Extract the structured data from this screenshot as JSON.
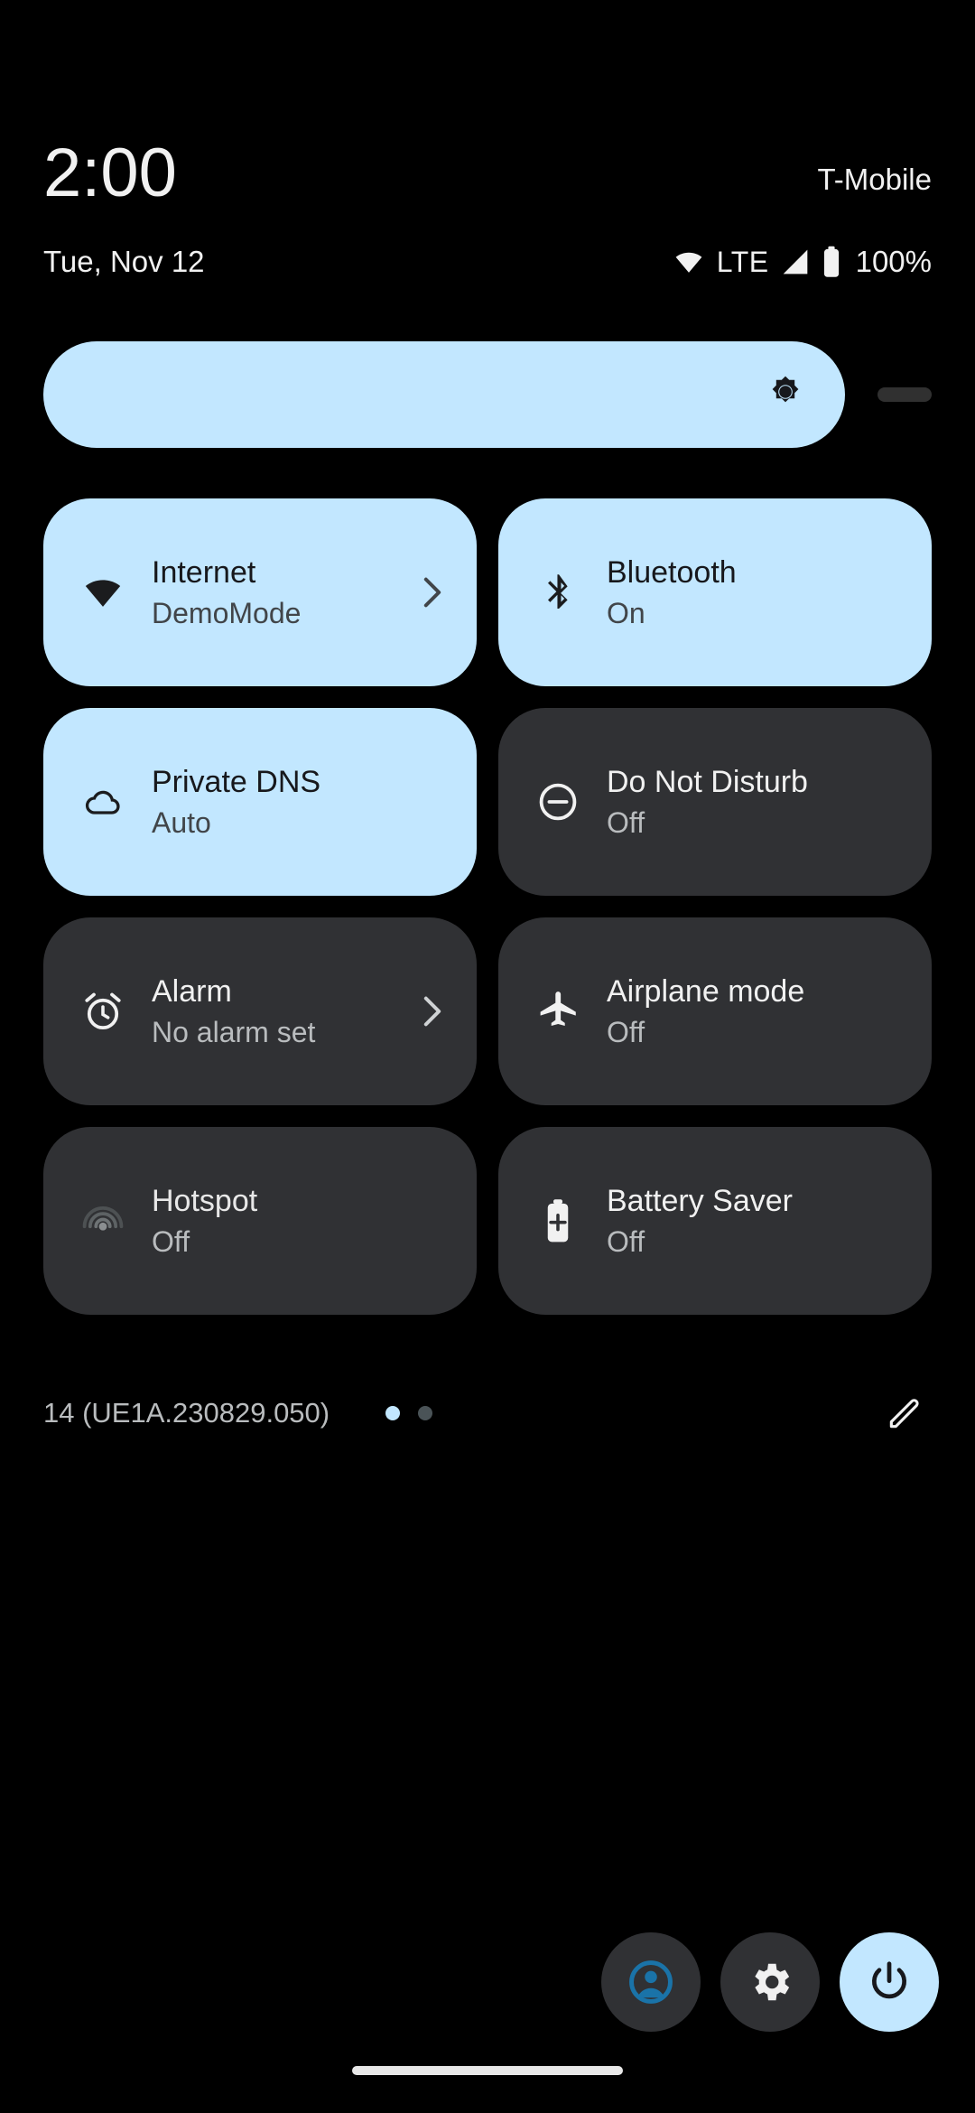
{
  "status_bar": {
    "time": "2:00",
    "date": "Tue, Nov 12",
    "carrier": "T-Mobile",
    "network_type": "LTE",
    "battery_percent": "100%",
    "wifi_icon": "wifi-icon",
    "signal_icon": "cell-signal-icon",
    "battery_icon": "battery-full-icon"
  },
  "brightness": {
    "icon": "brightness-icon",
    "level_percent": 90,
    "label": "Brightness"
  },
  "tiles": [
    {
      "label": "Internet",
      "sub": "DemoMode",
      "state": "active",
      "icon": "wifi-icon",
      "chevron": true
    },
    {
      "label": "Bluetooth",
      "sub": "On",
      "state": "active",
      "icon": "bluetooth-icon",
      "chevron": false
    },
    {
      "label": "Private DNS",
      "sub": "Auto",
      "state": "active",
      "icon": "cloud-icon",
      "chevron": false
    },
    {
      "label": "Do Not Disturb",
      "sub": "Off",
      "state": "inactive",
      "icon": "do-not-disturb-icon",
      "chevron": false
    },
    {
      "label": "Alarm",
      "sub": "No alarm set",
      "state": "inactive",
      "icon": "alarm-icon",
      "chevron": true
    },
    {
      "label": "Airplane mode",
      "sub": "Off",
      "state": "inactive",
      "icon": "airplane-icon",
      "chevron": false
    },
    {
      "label": "Hotspot",
      "sub": "Off",
      "state": "dimmed",
      "icon": "hotspot-icon",
      "chevron": false
    },
    {
      "label": "Battery Saver",
      "sub": "Off",
      "state": "inactive",
      "icon": "battery-saver-icon",
      "chevron": false
    }
  ],
  "footer": {
    "build": "14 (UE1A.230829.050)",
    "page_current": 1,
    "page_total": 2,
    "edit_icon": "pencil-edit-icon"
  },
  "bottom_actions": [
    {
      "name": "user-switcher-button",
      "icon": "user-avatar-icon",
      "style": "dark"
    },
    {
      "name": "settings-button",
      "icon": "gear-icon",
      "style": "dark"
    },
    {
      "name": "power-button",
      "icon": "power-icon",
      "style": "accent"
    }
  ],
  "colors": {
    "background": "#000000",
    "tile_active": "#C2E7FF",
    "tile_inactive": "#303134",
    "text_primary": "#F1F1F1",
    "text_secondary": "#B9BCBE",
    "avatar_accent": "#1A73A8"
  }
}
